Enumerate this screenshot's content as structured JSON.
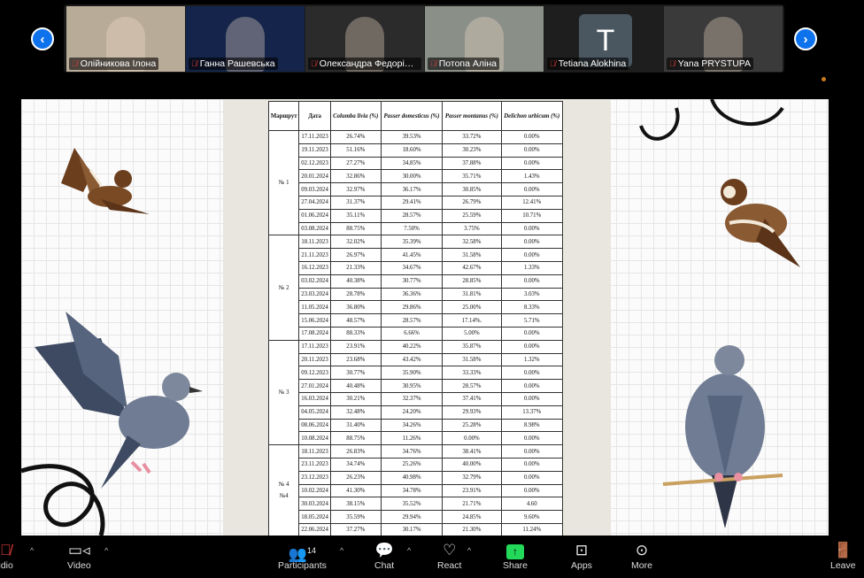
{
  "participants": [
    {
      "name": "Олійникова Ілона",
      "bg": "#b8ab98"
    },
    {
      "name": "Ганна Рашевська",
      "bg": "#14244a"
    },
    {
      "name": "Олександра Федоріно...",
      "bg": "#2b2b2b"
    },
    {
      "name": "Потопа Аліна",
      "bg": "#8a8f88"
    },
    {
      "name": "Tetiana Alokhina",
      "bg": "#1e1e1e",
      "initial": "T"
    },
    {
      "name": "Yana PRYSTUPA",
      "bg": "#3a3a3a"
    }
  ],
  "nav": {
    "prev": "‹",
    "next": "›"
  },
  "table": {
    "headers": [
      "Маршрут",
      "Дата",
      "Columba livia (%)",
      "Passer domesticus (%)",
      "Passer montanus (%)",
      "Delichon urbicum (%)"
    ],
    "groups": [
      {
        "route": "№ 1",
        "rows": [
          [
            "17.11.2023",
            "26.74%",
            "39.53%",
            "33.72%",
            "0.00%"
          ],
          [
            "19.11.2023",
            "51.16%",
            "18.60%",
            "30.23%",
            "0.00%"
          ],
          [
            "02.12.2023",
            "27.27%",
            "34.85%",
            "37.88%",
            "0.00%"
          ],
          [
            "20.01.2024",
            "32.86%",
            "30.00%",
            "35.71%",
            "1.43%"
          ],
          [
            "09.03.2024",
            "32.97%",
            "36.17%",
            "30.85%",
            "0.00%"
          ],
          [
            "27.04.2024",
            "31.37%",
            "29.41%",
            "26.79%",
            "12.41%"
          ],
          [
            "01.06.2024",
            "35.11%",
            "28.57%",
            "25.59%",
            "10.71%"
          ],
          [
            "03.08.2024",
            "88.75%",
            "7.50%",
            "3.75%",
            "0.00%"
          ]
        ]
      },
      {
        "route": "№ 2",
        "rows": [
          [
            "18.11.2023",
            "32.02%",
            "35.39%",
            "32.58%",
            "0.00%"
          ],
          [
            "21.11.2023",
            "26.97%",
            "41.45%",
            "31.58%",
            "0.00%"
          ],
          [
            "16.12.2023",
            "21.33%",
            "34.67%",
            "42.67%",
            "1.33%"
          ],
          [
            "03.02.2024",
            "40.38%",
            "30.77%",
            "28.85%",
            "0.00%"
          ],
          [
            "23.03.2024",
            "28.78%",
            "36.36%",
            "31.81%",
            "3.03%"
          ],
          [
            "11.05.2024",
            "36.80%",
            "29.86%",
            "25.00%",
            "8.33%"
          ],
          [
            "15.06.2024",
            "48.57%",
            "28.57%",
            "17.14%.",
            "5.71%"
          ],
          [
            "17.08.2024",
            "88.33%",
            "6.66%",
            "5.00%",
            "0.00%"
          ]
        ]
      },
      {
        "route": "№ 3",
        "rows": [
          [
            "17.11.2023",
            "23.91%",
            "40.22%",
            "35.87%",
            "0.00%"
          ],
          [
            "20.11.2023",
            "23.68%",
            "43.42%",
            "31.58%",
            "1.32%"
          ],
          [
            "09.12.2023",
            "30.77%",
            "35.90%",
            "33.33%",
            "0.00%"
          ],
          [
            "27.01.2024",
            "40.48%",
            "30.95%",
            "28.57%",
            "0.00%"
          ],
          [
            "16.03.2024",
            "30.21%",
            "32.37%",
            "37.41%",
            "0.00%"
          ],
          [
            "04.05.2024",
            "32.48%",
            "24.20%",
            "29.93%",
            "13.37%"
          ],
          [
            "08.06.2024",
            "31.40%",
            "34.26%",
            "25.28%",
            "8.98%"
          ],
          [
            "10.08.2024",
            "88.75%",
            "11.26%",
            "0.00%",
            "0.00%"
          ]
        ]
      },
      {
        "route": "№ 4",
        "route2": "№4",
        "rows": [
          [
            "18.11.2023",
            "26.83%",
            "34.76%",
            "38.41%",
            "0.00%"
          ],
          [
            "23.11.2023",
            "34.74%",
            "25.26%",
            "40.00%",
            "0.00%"
          ],
          [
            "23.12.2023",
            "26.23%",
            "40.98%",
            "32.79%",
            "0.00%"
          ],
          [
            "10.02.2024",
            "41.30%",
            "34.78%",
            "23.91%",
            "0.00%"
          ],
          [
            "30.03.2024",
            "38.15%",
            "35.52%",
            "21.71%",
            "4.60"
          ],
          [
            "18.05.2024",
            "35.59%",
            "29.94%",
            "24.85%",
            "9.60%"
          ],
          [
            "22.06.2024",
            "37.27%",
            "30.17%",
            "21.30%",
            "11.24%"
          ]
        ]
      }
    ]
  },
  "toolbar": {
    "audio": "Audio",
    "video": "Video",
    "participants": "Participants",
    "participants_count": "14",
    "chat": "Chat",
    "react": "React",
    "share": "Share",
    "apps": "Apps",
    "more": "More",
    "leave": "Leave"
  },
  "colors": {
    "accent": "#0e72ed",
    "share": "#23d959",
    "muted": "#e23b3b",
    "leave": "#e0245e"
  }
}
